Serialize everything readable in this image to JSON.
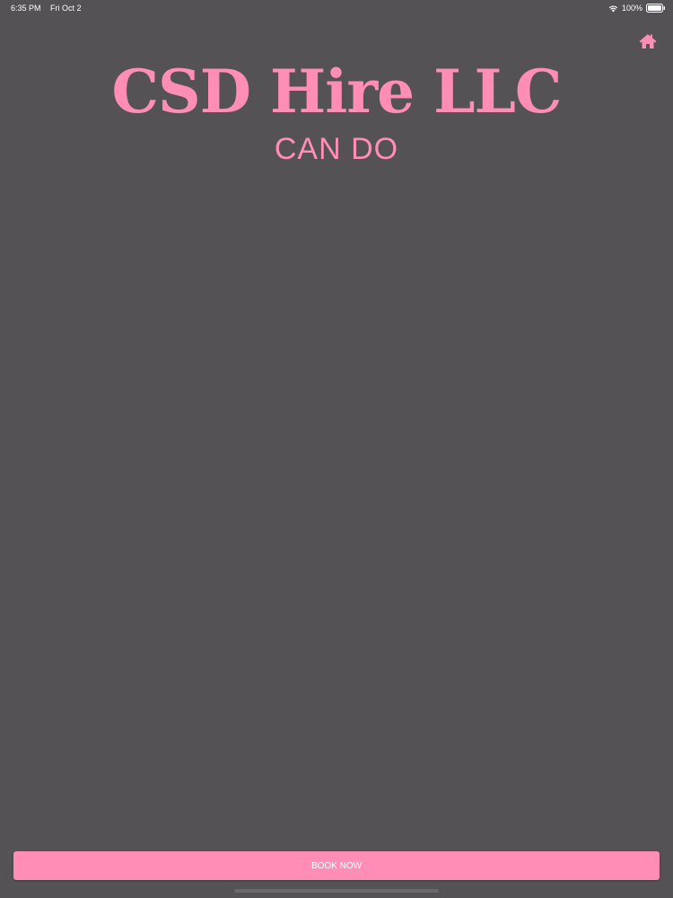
{
  "status_bar": {
    "time": "6:35 PM",
    "date": "Fri Oct 2",
    "battery": "100%",
    "wifi_icon": "wifi-icon",
    "battery_icon": "battery-icon"
  },
  "header": {
    "home_icon": "home-icon",
    "title": "CSD Hire LLC",
    "subtitle": "CAN DO"
  },
  "footer": {
    "book_label": "BOOK NOW"
  },
  "colors": {
    "background": "#545254",
    "accent": "#ff8db5",
    "text_light": "#ffffff"
  }
}
